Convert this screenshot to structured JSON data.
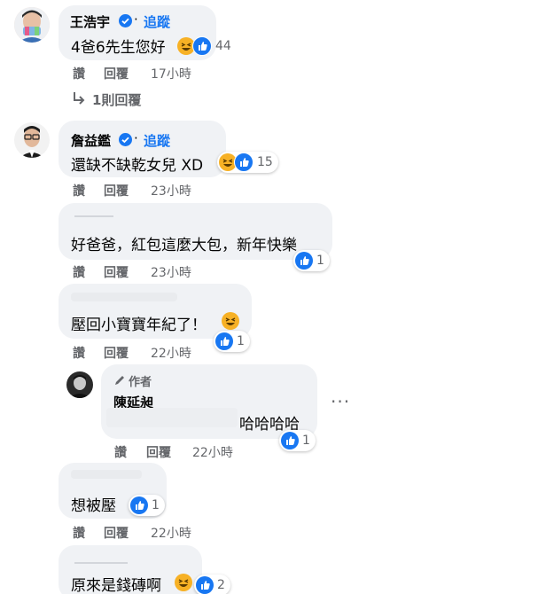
{
  "comments": [
    {
      "author": "王浩宇",
      "follow_label": "追蹤",
      "text": "4爸6先生您好",
      "reaction_count": "44",
      "like_label": "讚",
      "reply_label": "回覆",
      "time": "17小時"
    },
    {
      "author": "詹益鑑",
      "follow_label": "追蹤",
      "text": "還缺不缺乾女兒 XD",
      "reaction_count": "15",
      "like_label": "讚",
      "reply_label": "回覆",
      "time": "23小時"
    },
    {
      "author": "",
      "text": "好爸爸，紅包這麼大包，新年快樂",
      "reaction_count": "1",
      "like_label": "讚",
      "reply_label": "回覆",
      "time": "23小時"
    },
    {
      "author": "",
      "text": "壓回小寶寶年紀了！",
      "reaction_count": "1",
      "like_label": "讚",
      "reply_label": "回覆",
      "time": "22小時"
    },
    {
      "author": "",
      "text": "想被壓",
      "reaction_count": "1",
      "like_label": "讚",
      "reply_label": "回覆",
      "time": "22小時"
    },
    {
      "author": "",
      "text": "原來是錢磚啊",
      "reaction_count": "2"
    }
  ],
  "view_replies": "1則回覆",
  "author_reply": {
    "badge": "作者",
    "author": "陳延昶",
    "text": "哈哈哈哈",
    "reaction_count": "1",
    "like_label": "讚",
    "reply_label": "回覆",
    "time": "22小時"
  },
  "colors": {
    "bubble": "#f0f2f5",
    "accent": "#1877f2",
    "meta": "#65676b"
  },
  "icons": [
    "verified-badge-icon",
    "like-reaction-icon",
    "haha-reaction-icon",
    "reply-arrow-icon",
    "author-pen-icon"
  ]
}
